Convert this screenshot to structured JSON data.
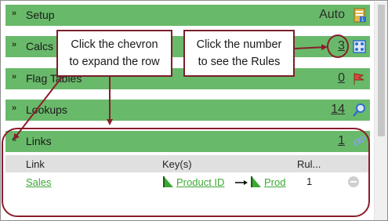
{
  "rows": [
    {
      "chevron": "»",
      "label": "Setup",
      "value": "Auto",
      "icon": "setup-icon"
    },
    {
      "chevron": "»",
      "label": "Calcs",
      "value": "3",
      "icon": "calcs-icon"
    },
    {
      "chevron": "»",
      "label": "Flag Tables",
      "value": "0",
      "icon": "flag-icon"
    },
    {
      "chevron": "»",
      "label": "Lookups",
      "value": "14",
      "icon": "lookup-icon"
    },
    {
      "chevron": "«",
      "label": "Links",
      "value": "1",
      "icon": "link-icon"
    }
  ],
  "links_table": {
    "headers": [
      "Link",
      "Key(s)",
      "Rul..."
    ],
    "rows": [
      {
        "link": "Sales",
        "key1": "Product ID",
        "key2": "Prod",
        "rules": "1"
      }
    ]
  },
  "callouts": {
    "chevron_line1": "Click the chevron",
    "chevron_line2": "to expand the row",
    "number_line1": "Click the number",
    "number_line2": "to see the Rules"
  },
  "colors": {
    "row_green": "#69b96a",
    "callout_border": "#7a1f2b",
    "link_green": "#3aa833"
  }
}
